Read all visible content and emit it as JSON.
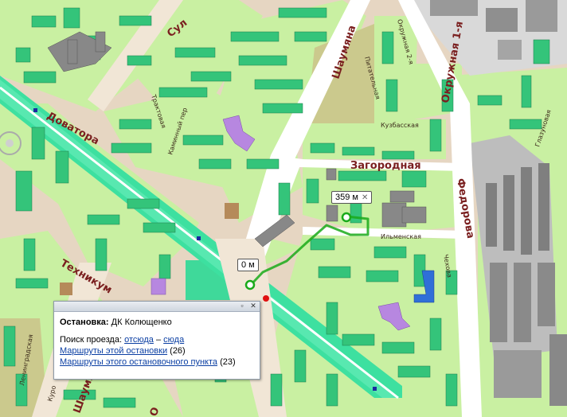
{
  "streets": {
    "sulimova": "Сул",
    "shaumyana_top": "Шаумяна",
    "okruzhnaya_1": "Окружная 1-я",
    "okruzhnaya_2": "Окружная 2-я",
    "pitatelnaya": "Питательная",
    "dovatora": "Доватора",
    "traktovaya": "Трактовая",
    "kaminny_per": "Каминный пер",
    "kuzbasskaya": "Кузбасская",
    "zagorodnaya": "Загородная",
    "fedorova": "Федорова",
    "ilmenskaya": "Ильменская",
    "tekhnikum": "Техникум",
    "chekhova": "Чехова",
    "glazunovaya": "Глазуновая",
    "leningradskaya": "Ленинградская",
    "shaumyana_bottom": "Шаумя",
    "kuro": "Куро",
    "o_bottom": "О"
  },
  "route": {
    "end_label": "359 м",
    "start_label": "0 м",
    "close_glyph": "✕"
  },
  "popup": {
    "stop_title": "Остановка:",
    "stop_name": "ДК Колющенко",
    "search_label": "Поиск проезда:",
    "from_here": "отсюда",
    "dash": "–",
    "to_here": "сюда",
    "routes_this_stop": "Маршруты этой остановки",
    "routes_this_stop_count": "(26)",
    "routes_stop_point": "Маршруты этого остановочного пункта",
    "routes_stop_point_count": "(23)",
    "btn_restore": "▫",
    "btn_close": "✕"
  },
  "colors": {
    "block_green": "#c8f0a0",
    "building_green": "#34c47a",
    "road_main": "#3de0a0",
    "route_line": "#1aaa1a",
    "stop_red": "#e01010",
    "building_gray": "#888888",
    "building_purple": "#b787e0",
    "building_blue": "#2f6fd8"
  }
}
